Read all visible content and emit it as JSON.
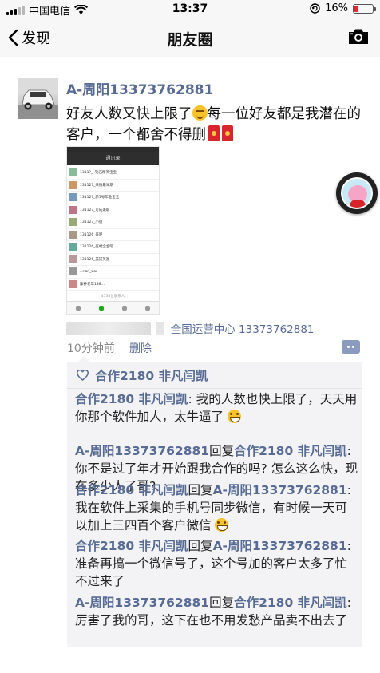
{
  "status_bar": {
    "carrier": "中国电信",
    "time": "13:37",
    "battery": "16%",
    "battery_level": 0.16
  },
  "nav": {
    "back_label": "发现",
    "title": "朋友圈"
  },
  "post": {
    "author": "A-周阳13373762881",
    "text_part1": "好友人数又快上限了",
    "text_part2": "每一位好友都是我潜在的客户，一个都舍不得删",
    "image": {
      "title": "通讯录",
      "rows": [
        "1311?_..钻石精英宝宝",
        "131127_采购最早期",
        "131127_新1号年金宝宝",
        "131127_可成兼职",
        "131127_小盘",
        "131126_来吧",
        "131126_在村全合吧",
        "131126_美搓英富",
        "...Fan_Bar",
        "康养老年138..."
      ],
      "count": "4738位联系人"
    },
    "source": "_全国运营中心 13373762881",
    "time": "10分钟前",
    "delete_label": "删除"
  },
  "likes": {
    "names": "合作2180 非凡闫凯"
  },
  "comments": [
    {
      "author": "合作2180 非凡闫凯",
      "reply_word": "",
      "reply_to": "",
      "text": ": 我的人数也快上限了，天天用你那个软件加人，太牛逼了",
      "emoji": true
    },
    {
      "author": "A-周阳13373762881",
      "reply_word": "回复",
      "reply_to": "合作2180 非凡闫凯",
      "text": ": 你不是过了年才开始跟我合作的吗? 怎么这么快，现在多少人了哥?",
      "emoji": false
    },
    {
      "author": "合作2180 非凡闫凯",
      "reply_word": "回复",
      "reply_to": "A-周阳13373762881",
      "text": ": 我在软件上采集的手机号同步微信，有时候一天可以加上三四百个客户微信",
      "emoji": true
    },
    {
      "author": "合作2180 非凡闫凯",
      "reply_word": "回复",
      "reply_to": "A-周阳13373762881",
      "text": ": 准备再搞一个微信号了，这个号加的客户太多了忙不过来了",
      "emoji": false
    },
    {
      "author": "A-周阳13373762881",
      "reply_word": "回复",
      "reply_to": "合作2180 非凡闫凯",
      "text": ": 厉害了我的哥，这下在也不用发愁产品卖不出去了",
      "emoji": false
    }
  ],
  "colors": {
    "link": "#576b95",
    "comment_bg": "#f3f3f5",
    "battery_red": "#e0262e"
  },
  "icons": [
    "signal-icon",
    "wifi-icon",
    "back-chevron-icon",
    "camera-icon",
    "location-lock-icon",
    "battery-icon",
    "heart-icon",
    "more-icon",
    "grin-emoji-icon",
    "red-envelope-icon"
  ]
}
